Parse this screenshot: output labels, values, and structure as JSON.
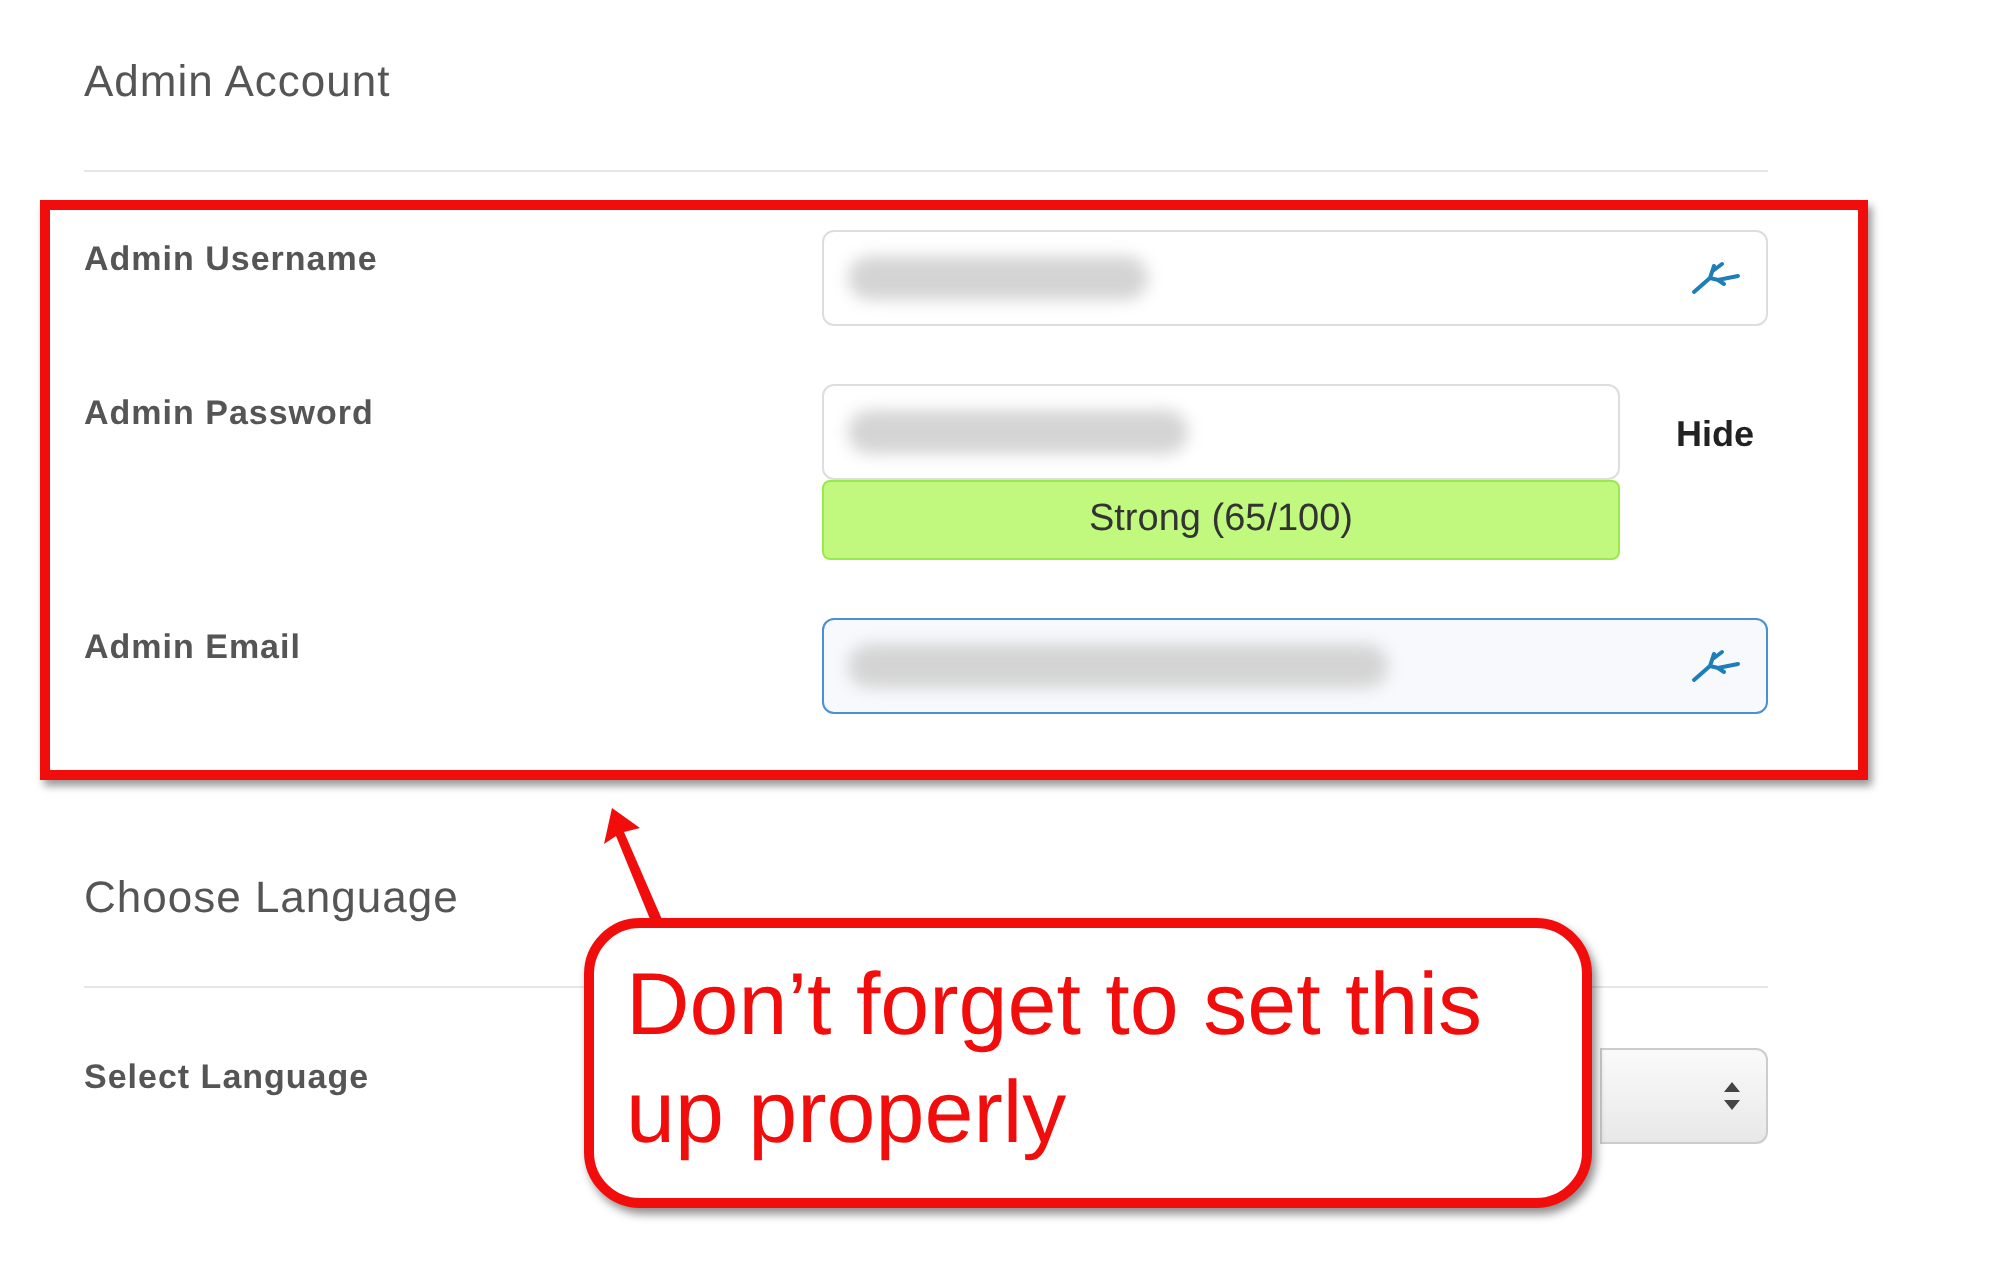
{
  "sections": [
    {
      "title": "Admin Account",
      "highlighted": true,
      "fields": [
        {
          "label": "Admin Username",
          "kind": "text",
          "focused": false
        },
        {
          "label": "Admin Password",
          "kind": "password",
          "focused": false,
          "toggle": "Hide",
          "strength": "Strong (65/100)"
        },
        {
          "label": "Admin Email",
          "kind": "text",
          "focused": true
        }
      ]
    },
    {
      "title": "Choose Language",
      "highlighted": false,
      "fields": [
        {
          "label": "Select Language",
          "kind": "select",
          "focused": false
        }
      ]
    }
  ],
  "callout": {
    "text": "Don’t forget to set this up properly"
  }
}
